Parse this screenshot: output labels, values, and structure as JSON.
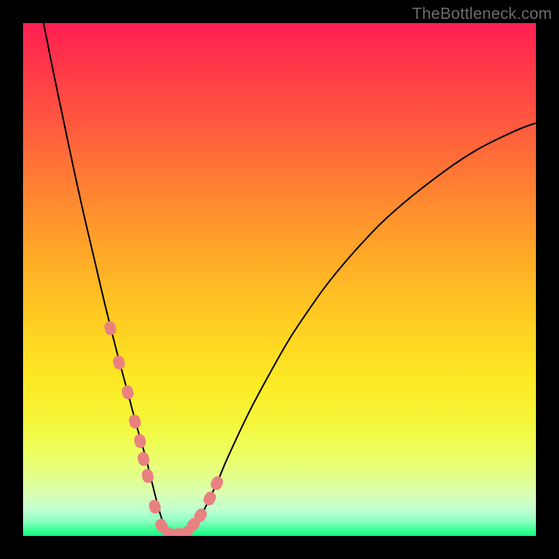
{
  "watermark": "TheBottleneck.com",
  "colors": {
    "frame_bg": "#000000",
    "curve_stroke": "#000000",
    "marker_fill": "#e98181",
    "gradient_top": "#ff1f53",
    "gradient_bottom": "#0aff7d"
  },
  "chart_data": {
    "type": "line",
    "title": "",
    "xlabel": "",
    "ylabel": "",
    "xlim": [
      0,
      100
    ],
    "ylim": [
      0,
      100
    ],
    "grid": false,
    "legend": false,
    "series": [
      {
        "name": "bottleneck-curve",
        "x": [
          4,
          6,
          8,
          10,
          12,
          14,
          16,
          18,
          20,
          22,
          23,
          24,
          25,
          26,
          27,
          28,
          30,
          32,
          34,
          36,
          38,
          40,
          44,
          48,
          52,
          56,
          60,
          66,
          72,
          80,
          88,
          96,
          100
        ],
        "values": [
          100,
          90,
          80.5,
          71,
          62,
          53.5,
          45,
          37,
          29.5,
          22,
          18.5,
          15,
          11,
          7,
          3.5,
          1.5,
          0.3,
          0.6,
          2.8,
          6.5,
          10.8,
          15.5,
          24,
          31.5,
          38.5,
          44.5,
          50,
          57,
          63,
          69.5,
          75,
          79,
          80.5
        ]
      }
    ],
    "markers": {
      "name": "highlight-points",
      "x": [
        17.0,
        18.7,
        20.4,
        21.8,
        22.8,
        23.5,
        24.3,
        25.7,
        27.0,
        28.5,
        30.2,
        31.8,
        33.2,
        34.6,
        36.4,
        37.8
      ],
      "values": [
        40.5,
        33.8,
        28.0,
        22.3,
        18.5,
        15.0,
        11.7,
        5.7,
        2.0,
        0.5,
        0.4,
        0.7,
        2.2,
        4.0,
        7.3,
        10.3
      ]
    }
  }
}
